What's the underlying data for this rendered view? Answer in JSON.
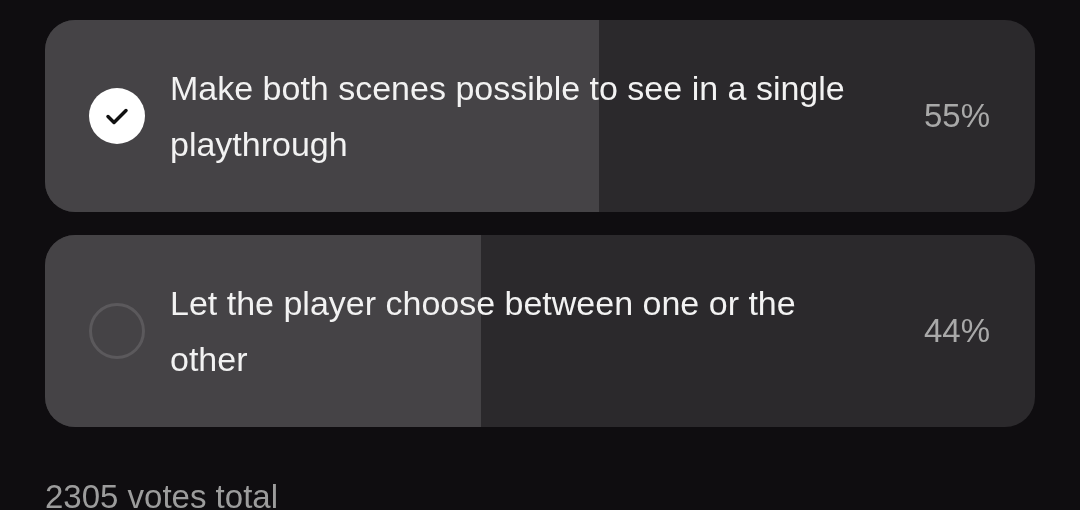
{
  "poll": {
    "options": [
      {
        "label": "Make both scenes possible to see in a single playthrough",
        "percent": "55%",
        "level": 0.56,
        "selected": true
      },
      {
        "label": "Let the player choose between one or the other",
        "percent": "44%",
        "level": 0.44,
        "selected": false
      }
    ],
    "total": "2305 votes total"
  }
}
